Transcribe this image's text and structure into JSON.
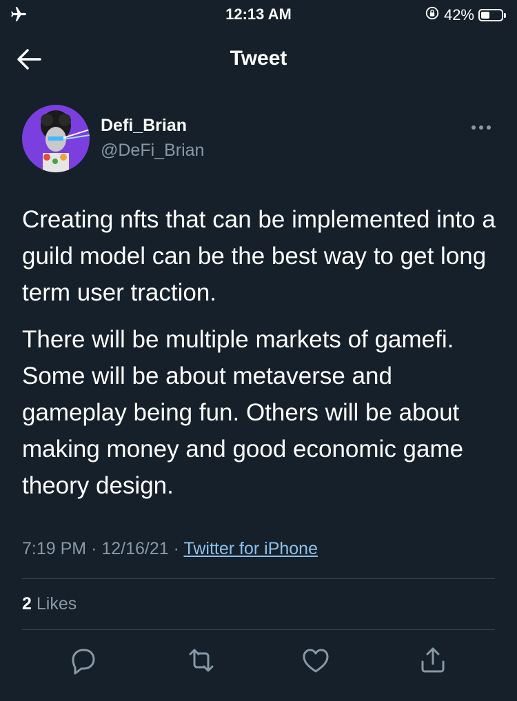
{
  "status_bar": {
    "time": "12:13 AM",
    "battery_percent_label": "42%",
    "battery_level": 0.42,
    "icons": [
      "airplane-icon",
      "orientation-lock-icon",
      "battery-icon"
    ]
  },
  "header": {
    "title": "Tweet",
    "back_icon": "arrow-left-icon"
  },
  "tweet": {
    "author": {
      "display_name": "Defi_Brian",
      "handle": "@DeFi_Brian"
    },
    "paragraphs": [
      "Creating nfts that can be implemented into a guild model can be the best way to get long term user traction.",
      "There will be multiple markets of gamefi. Some will be about metaverse and gameplay being fun. Others will be about making money and good economic game theory design."
    ],
    "time": "7:19 PM",
    "separator": "·",
    "date": "12/16/21",
    "source": "Twitter for iPhone",
    "likes_count": "2",
    "likes_label": "Likes"
  },
  "actions": [
    "reply-icon",
    "retweet-icon",
    "like-icon",
    "share-icon"
  ],
  "colors": {
    "background": "#15202b",
    "secondary_text": "#8899a6",
    "divider": "#38444d",
    "link": "#8ec0ea"
  }
}
